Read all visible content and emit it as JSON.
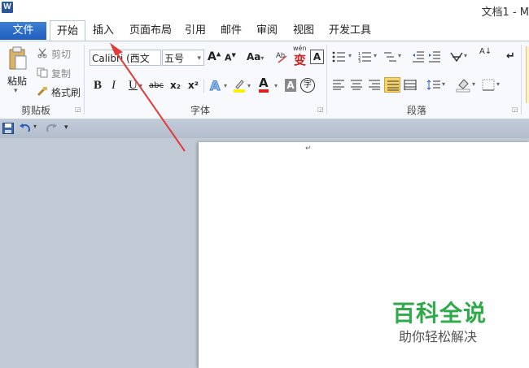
{
  "title_bar": {
    "app_logo": "W",
    "doc_title": "文档1 - M"
  },
  "tabs": [
    "文件",
    "开始",
    "插入",
    "页面布局",
    "引用",
    "邮件",
    "审阅",
    "视图",
    "开发工具"
  ],
  "clipboard": {
    "paste": "粘贴",
    "cut": "剪切",
    "copy": "复制",
    "format_painter": "格式刷",
    "group": "剪贴板"
  },
  "font": {
    "font_name": "Calibri (西文",
    "font_size": "五号",
    "aa_label": "Aa",
    "group": "字体",
    "bold": "B",
    "italic": "I",
    "underline": "U",
    "strike": "abc",
    "subscript": "x₂",
    "superscript": "x²",
    "wen": "wén",
    "wen_char": "变",
    "char_border": "A",
    "shade_a": "A",
    "enclose": "字",
    "grow": "A",
    "shrink": "A",
    "text_effect": "A",
    "font_color": "A"
  },
  "paragraph": {
    "group": "段落",
    "sort": "A↓"
  },
  "document": {
    "cursor": "↵"
  },
  "watermark": {
    "main": "百科全说",
    "sub": "助你轻松解决"
  },
  "colors": {
    "file_tab": "#2b5fbd",
    "highlight": "#ffee00",
    "font_color": "#e02020",
    "arrow": "#e23b3b",
    "watermark": "#2faa4a"
  }
}
